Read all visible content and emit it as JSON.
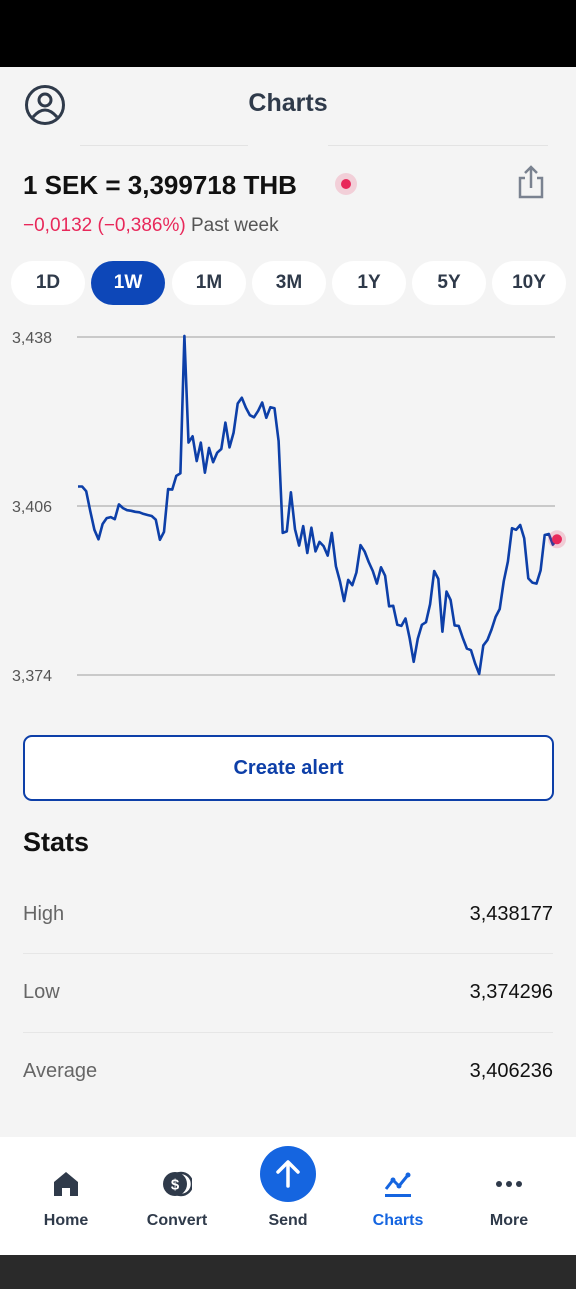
{
  "header": {
    "title": "Charts"
  },
  "rate": {
    "text": "1 SEK = 3,399718 THB",
    "change": "−0,0132 (−0,386%)",
    "period": "Past week"
  },
  "periods": [
    "1D",
    "1W",
    "1M",
    "3M",
    "1Y",
    "5Y",
    "10Y"
  ],
  "active_period": "1W",
  "chart_data": {
    "type": "line",
    "y_ticks": [
      "3,438",
      "3,406",
      "3,374"
    ],
    "ylim": [
      3.374,
      3.438
    ],
    "grid": true,
    "series": [
      {
        "values": [
          3.4097,
          3.4097,
          3.4088,
          3.405,
          3.4015,
          3.3997,
          3.4026,
          3.4037,
          3.4039,
          3.4035,
          3.4063,
          3.4056,
          3.4052,
          3.4051,
          3.4049,
          3.4048,
          3.4045,
          3.4043,
          3.4041,
          3.4034,
          3.3996,
          3.4011,
          3.4092,
          3.4091,
          3.4117,
          3.4122,
          3.4382,
          3.418,
          3.4192,
          3.4145,
          3.418,
          3.4123,
          3.417,
          3.4143,
          3.4161,
          3.4168,
          3.4218,
          3.4171,
          3.4199,
          3.4254,
          3.4265,
          3.4246,
          3.4232,
          3.4228,
          3.424,
          3.4256,
          3.4227,
          3.4247,
          3.4245,
          3.4183,
          3.4009,
          3.4012,
          3.4086,
          3.4016,
          3.3985,
          3.4022,
          3.3971,
          3.4019,
          3.3974,
          3.3992,
          3.3984,
          3.3966,
          3.4009,
          3.3946,
          3.3917,
          3.388,
          3.392,
          3.391,
          3.3934,
          3.3986,
          3.3974,
          3.3954,
          3.3937,
          3.3913,
          3.3944,
          3.3928,
          3.387,
          3.3871,
          3.3835,
          3.3833,
          3.3847,
          3.381,
          3.3765,
          3.3809,
          3.3835,
          3.384,
          3.3874,
          3.3937,
          3.3922,
          3.3822,
          3.3898,
          3.3882,
          3.3834,
          3.3833,
          3.381,
          3.379,
          3.3787,
          3.3762,
          3.3742,
          3.3796,
          3.3806,
          3.3826,
          3.385,
          3.3865,
          3.3918,
          3.3955,
          3.4018,
          3.4015,
          3.4024,
          3.3999,
          3.3923,
          3.3915,
          3.3913,
          3.3938,
          3.4005,
          3.4007,
          3.3987,
          3.3997
        ]
      }
    ]
  },
  "create_alert": "Create alert",
  "stats": {
    "title": "Stats",
    "rows": [
      {
        "label": "High",
        "value": "3,438177"
      },
      {
        "label": "Low",
        "value": "3,374296"
      },
      {
        "label": "Average",
        "value": "3,406236"
      }
    ]
  },
  "nav": [
    {
      "label": "Home",
      "icon": "home-icon"
    },
    {
      "label": "Convert",
      "icon": "convert-icon"
    },
    {
      "label": "Send",
      "icon": "send-icon"
    },
    {
      "label": "Charts",
      "icon": "charts-icon"
    },
    {
      "label": "More",
      "icon": "more-icon"
    }
  ],
  "colors": {
    "accent": "#0d47b8",
    "negative": "#e8285a",
    "line": "#0d3fa8"
  }
}
